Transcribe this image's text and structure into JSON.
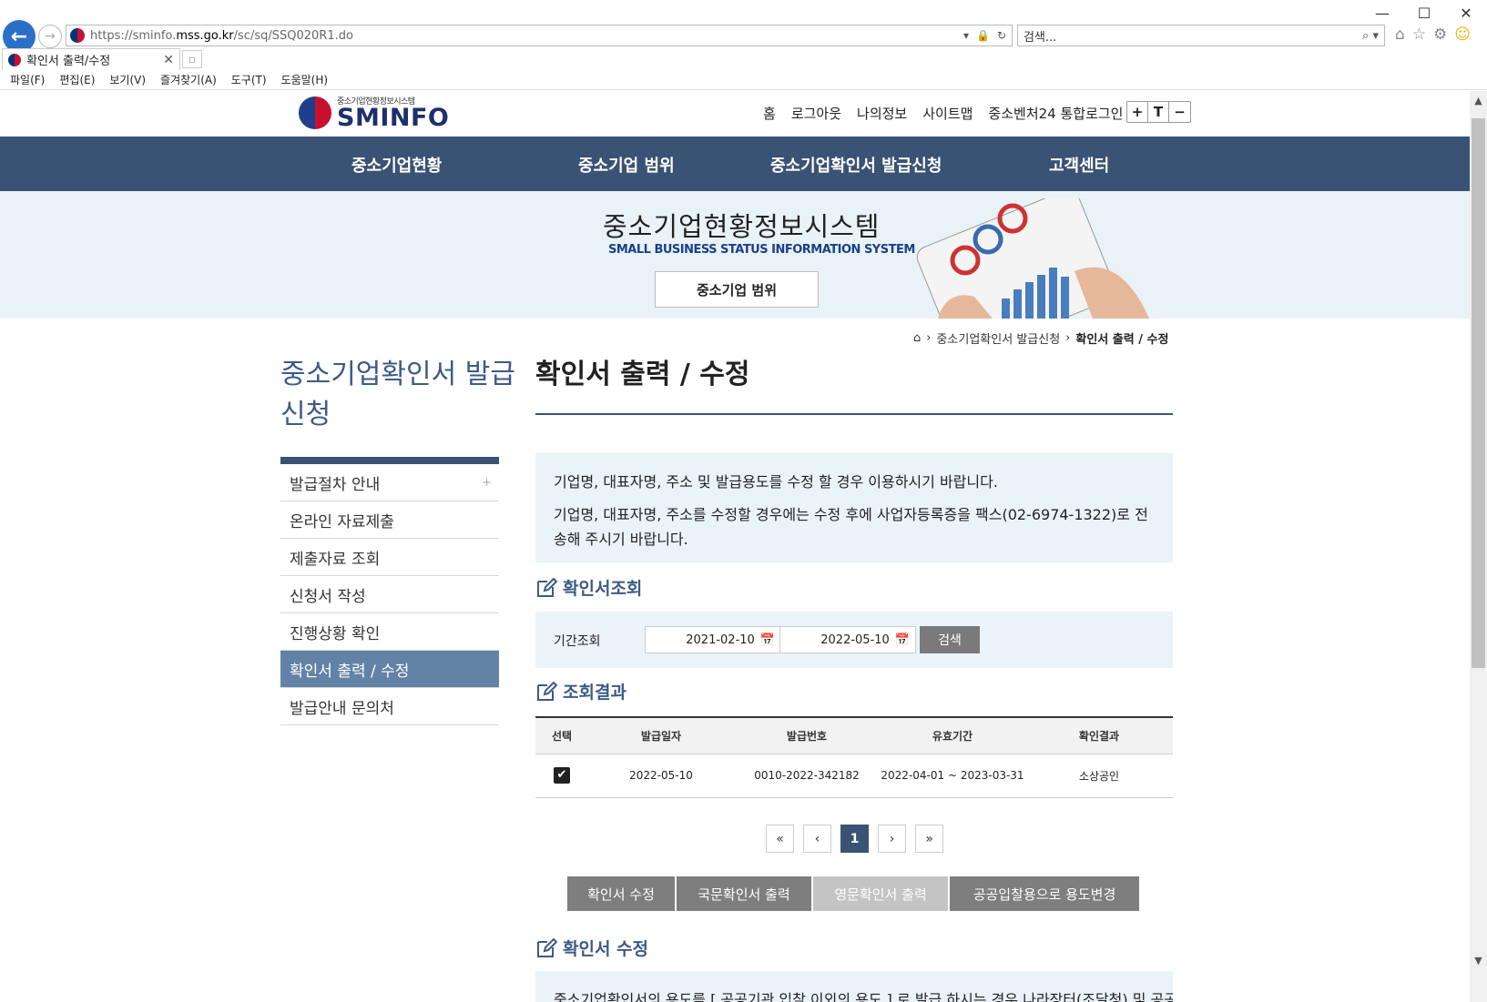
{
  "browser": {
    "url_prefix": "https://sminfo.",
    "url_host": "mss.go.kr",
    "url_path": "/sc/sq/SSQ020R1.do",
    "search_placeholder": "검색...",
    "tab_title": "확인서 출력/수정",
    "menu": [
      "파일(F)",
      "편집(E)",
      "보기(V)",
      "즐겨찾기(A)",
      "도구(T)",
      "도움말(H)"
    ]
  },
  "site": {
    "logo_sub": "중소기업현황정보시스템",
    "logo_main": "SMINFO",
    "util_links": [
      "홈",
      "로그아웃",
      "나의정보",
      "사이트맵",
      "중소벤처24 통합로그인"
    ],
    "font_controls": [
      "+",
      "T",
      "−"
    ],
    "gnb": [
      "중소기업현황",
      "중소기업 범위",
      "중소기업확인서 발급신청",
      "고객센터"
    ]
  },
  "hero": {
    "title": "중소기업현황정보시스템",
    "subtitle": "SMALL BUSINESS STATUS INFORMATION SYSTEM",
    "button": "중소기업 범위"
  },
  "breadcrumb": [
    "중소기업확인서 발급신청",
    "확인서 출력 / 수정"
  ],
  "sidebar": {
    "title": "중소기업확인서 발급신청",
    "items": [
      {
        "label": "발급절차 안내"
      },
      {
        "label": "온라인 자료제출"
      },
      {
        "label": "제출자료 조회"
      },
      {
        "label": "신청서 작성"
      },
      {
        "label": "진행상황 확인"
      },
      {
        "label": "확인서 출력 / 수정"
      },
      {
        "label": "발급안내 문의처"
      }
    ]
  },
  "main": {
    "title": "확인서 출력 / 수정",
    "notice1": "기업명, 대표자명, 주소 및 발급용도를 수정 할 경우 이용하시기 바랍니다.",
    "notice2": "기업명, 대표자명, 주소를 수정할 경우에는 수정 후에 사업자등록증을 팩스(02-6974-1322)로 전송해 주시기 바랍니다.",
    "section_search": "확인서조회",
    "period_label": "기간조회",
    "date_from": "2021-02-10",
    "date_to": "2022-05-10",
    "search_button": "검색",
    "section_result": "조회결과",
    "table": {
      "headers": [
        "선택",
        "발급일자",
        "발급번호",
        "유효기간",
        "확인결과"
      ],
      "rows": [
        [
          "2022-05-10",
          "0010-2022-342182",
          "2022-04-01 ~ 2023-03-31",
          "소상공인"
        ]
      ]
    },
    "pager": [
      "«",
      "‹",
      "1",
      "›",
      "»"
    ],
    "actions": [
      "확인서 수정",
      "국문확인서 출력",
      "영문확인서 출력",
      "공공입찰용으로 용도변경"
    ],
    "section_edit": "확인서 수정",
    "bottom_note": "중소기업확인서의 용도를 [ 공공기관 입찰 이외의 용도 ] 로 발급 하시는 경우 나라장터(조달청) 및 공공구"
  }
}
